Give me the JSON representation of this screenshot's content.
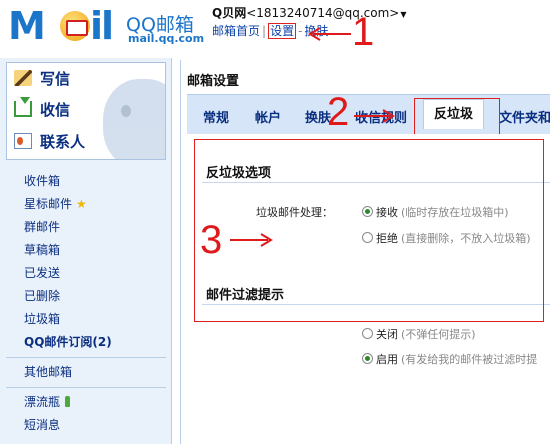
{
  "header": {
    "logo_text": "QQ邮箱",
    "logo_url": "mail.qq.com",
    "account_name": "Q贝网",
    "account_email": "<1813240714@qq.com>",
    "links": [
      "邮箱首页",
      "设置",
      "换肤"
    ]
  },
  "sidebar": {
    "big_items": [
      {
        "label": "写信",
        "icon": "pencil-icon"
      },
      {
        "label": "收信",
        "icon": "inbox-icon"
      },
      {
        "label": "联系人",
        "icon": "contacts-icon"
      }
    ],
    "folders": [
      "收件箱",
      "星标邮件",
      "群邮件",
      "草稿箱",
      "已发送",
      "已删除",
      "垃圾箱",
      "QQ邮件订阅(2)"
    ],
    "other": [
      "其他邮箱"
    ],
    "extras": [
      "漂流瓶",
      "短消息"
    ]
  },
  "main": {
    "title": "邮箱设置",
    "tabs": [
      "常规",
      "帐户",
      "换肤",
      "收信规则",
      "反垃圾",
      "文件夹和"
    ],
    "active_tab": "反垃圾"
  },
  "antispam": {
    "section_title": "反垃圾选项",
    "row_label": "垃圾邮件处理：",
    "options": [
      {
        "label": "接收",
        "hint": "(临时存放在垃圾箱中)",
        "checked": true
      },
      {
        "label": "拒绝",
        "hint": "(直接删除，不放入垃圾箱)",
        "checked": false
      }
    ]
  },
  "filter": {
    "section_title": "邮件过滤提示",
    "options": [
      {
        "label": "关闭",
        "hint": "(不弹任何提示)",
        "checked": false
      },
      {
        "label": "启用",
        "hint": "(有发给我的邮件被过滤时提",
        "checked": true
      }
    ]
  },
  "annotations": [
    "1",
    "2",
    "3"
  ],
  "colors": {
    "accent": "#1b75c9",
    "link": "#0b2f80",
    "annotation": "#e01a1a",
    "tabbar": "#d6e5f7"
  }
}
